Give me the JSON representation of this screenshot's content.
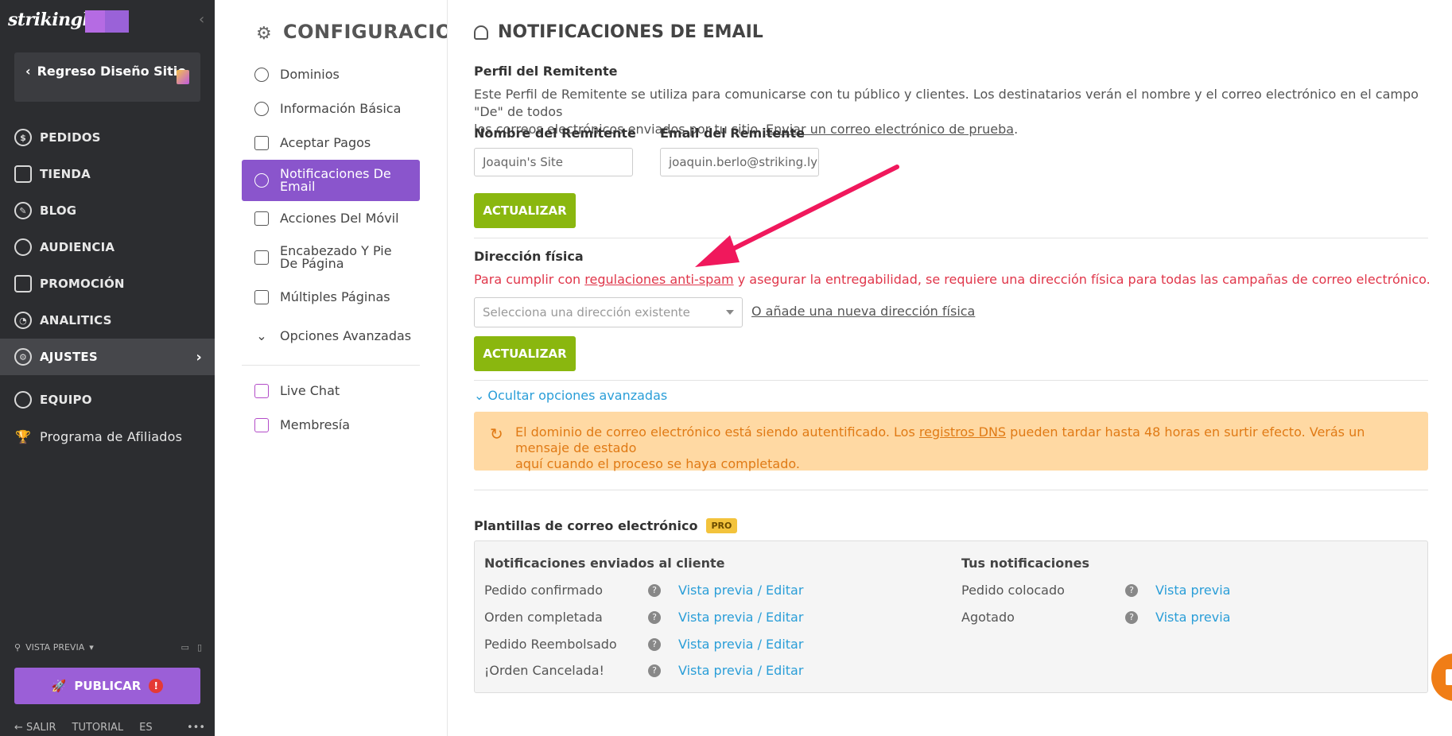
{
  "brand": {
    "logo_text": "strikingly"
  },
  "sidebar": {
    "back_label": "Regreso Diseño Sitio",
    "nav": [
      {
        "label": "PEDIDOS",
        "icon": "dollar-icon"
      },
      {
        "label": "TIENDA",
        "icon": "store-icon"
      },
      {
        "label": "BLOG",
        "icon": "feather-icon"
      },
      {
        "label": "AUDIENCIA",
        "icon": "people-icon"
      },
      {
        "label": "PROMOCIÓN",
        "icon": "megaphone-icon"
      },
      {
        "label": "ANALITICS",
        "icon": "pie-chart-icon"
      },
      {
        "label": "AJUSTES",
        "icon": "gear-icon"
      },
      {
        "label": "EQUIPO",
        "icon": "team-icon"
      },
      {
        "label": "Programa de Afiliados",
        "icon": "trophy-icon"
      }
    ],
    "preview_label": "VISTA PREVIA",
    "publish_label": "PUBLICAR",
    "footer": {
      "exit": "SALIR",
      "tutorial": "TUTORIAL",
      "lang": "ES",
      "more": "•••"
    }
  },
  "settings": {
    "title": "CONFIGURACION",
    "items": [
      {
        "label": "Dominios"
      },
      {
        "label": "Información Básica"
      },
      {
        "label": "Aceptar Pagos"
      },
      {
        "label": "Notificaciones De Email"
      },
      {
        "label": "Acciones Del Móvil"
      },
      {
        "label": "Encabezado Y Pie De Página"
      },
      {
        "label": "Múltiples Páginas"
      },
      {
        "label": "Opciones Avanzadas"
      },
      {
        "label": "Live Chat"
      },
      {
        "label": "Membresía"
      }
    ]
  },
  "main": {
    "title": "NOTIFICACIONES DE EMAIL",
    "sender": {
      "heading": "Perfil del Remitente",
      "desc_1": "Este Perfil de Remitente se utiliza para comunicarse con tu público y clientes. Los destinatarios verán el nombre y el correo electrónico en el campo \"De\" de todos",
      "desc_2": "los correos electrónicos enviados por tu sitio.",
      "test_link": "Enviar un correo electrónico de prueba",
      "name_label": "Nombre del Remitente",
      "name_value": "Joaquin's Site",
      "email_label": "Email del Remitente",
      "email_value": "joaquin.berlo@striking.ly",
      "update": "ACTUALIZAR"
    },
    "address": {
      "heading": "Dirección física",
      "warn_pre": "Para cumplir con",
      "warn_link": "regulaciones anti-spam",
      "warn_post": "y asegurar la entregabilidad, se requiere una dirección física para todas las campañas de correo electrónico.",
      "select_placeholder": "Selecciona una dirección existente",
      "add_link": "O añade una nueva dirección física",
      "update": "ACTUALIZAR"
    },
    "advanced_toggle": "Ocultar opciones avanzadas",
    "notice": {
      "pre": "El dominio de correo electrónico está siendo autentificado. Los",
      "link": "registros DNS",
      "post": "pueden tardar hasta 48 horas en surtir efecto. Verás un mensaje de estado",
      "line2": "aquí cuando el proceso se haya completado."
    },
    "templates": {
      "title": "Plantillas de correo electrónico",
      "badge": "PRO",
      "customer_head": "Notificaciones enviados al cliente",
      "yours_head": "Tus notificaciones",
      "customer_rows": [
        {
          "name": "Pedido confirmado",
          "action": "Vista previa / Editar"
        },
        {
          "name": "Orden completada",
          "action": "Vista previa / Editar"
        },
        {
          "name": "Pedido Reembolsado",
          "action": "Vista previa / Editar"
        },
        {
          "name": "¡Orden Cancelada!",
          "action": "Vista previa / Editar"
        }
      ],
      "your_rows": [
        {
          "name": "Pedido colocado",
          "action": "Vista previa"
        },
        {
          "name": "Agotado",
          "action": "Vista previa"
        }
      ]
    }
  },
  "colors": {
    "accent": "#8a55cc",
    "green": "#8ab70f",
    "link": "#2a9ed8",
    "warning": "#e0364a",
    "notice_bg": "#ffd9a3",
    "annotation_arrow": "#f0185c"
  }
}
